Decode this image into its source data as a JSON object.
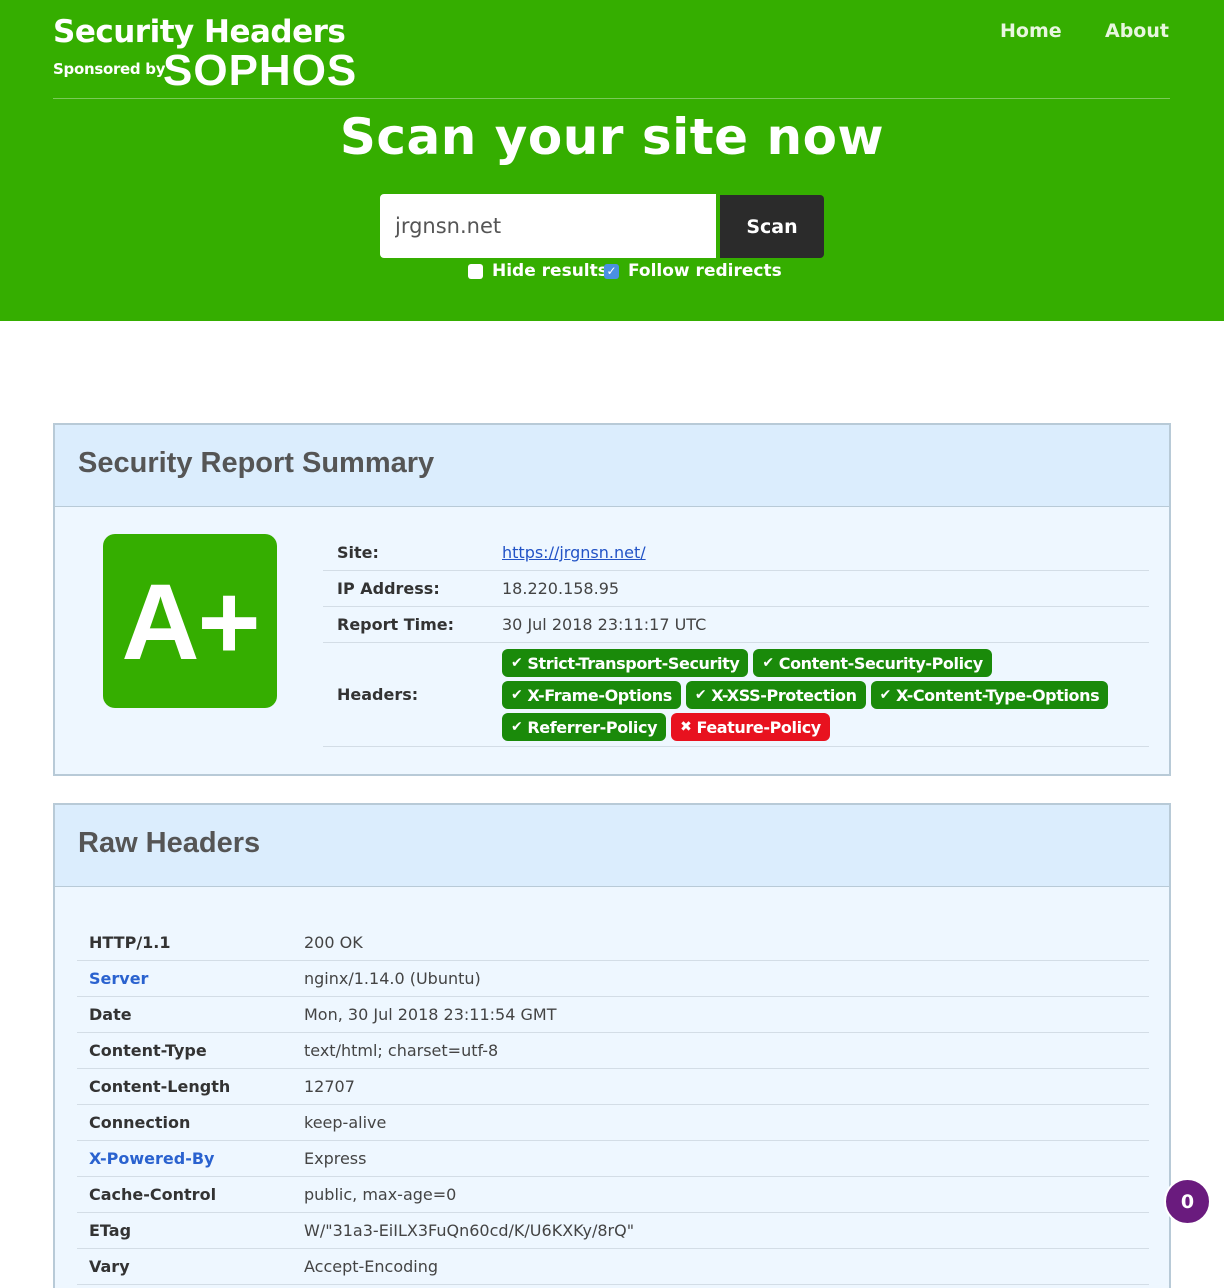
{
  "header": {
    "title": "Security Headers",
    "sponsored_by": "Sponsored by",
    "sponsor": "SOPHOS",
    "nav": {
      "home": "Home",
      "about": "About"
    },
    "heading": "Scan your site now",
    "search": {
      "value": "jrgnsn.net",
      "button": "Scan"
    },
    "options": {
      "hide_results": "Hide results",
      "hide_checked": false,
      "follow_redirects": "Follow redirects",
      "follow_checked": true
    }
  },
  "summary": {
    "title": "Security Report Summary",
    "grade": "A+",
    "site_label": "Site:",
    "site_value": "https://jrgnsn.net/",
    "ip_label": "IP Address:",
    "ip_value": "18.220.158.95",
    "time_label": "Report Time:",
    "time_value": "30 Jul 2018 23:11:17 UTC",
    "headers_label": "Headers:",
    "headers": [
      {
        "name": "Strict-Transport-Security",
        "status": "pass"
      },
      {
        "name": "Content-Security-Policy",
        "status": "pass"
      },
      {
        "name": "X-Frame-Options",
        "status": "pass"
      },
      {
        "name": "X-XSS-Protection",
        "status": "pass"
      },
      {
        "name": "X-Content-Type-Options",
        "status": "pass"
      },
      {
        "name": "Referrer-Policy",
        "status": "pass"
      },
      {
        "name": "Feature-Policy",
        "status": "fail"
      }
    ]
  },
  "raw": {
    "title": "Raw Headers",
    "rows": [
      {
        "key": "HTTP/1.1",
        "value": "200 OK",
        "highlight": false
      },
      {
        "key": "Server",
        "value": "nginx/1.14.0 (Ubuntu)",
        "highlight": true
      },
      {
        "key": "Date",
        "value": "Mon, 30 Jul 2018 23:11:54 GMT",
        "highlight": false
      },
      {
        "key": "Content-Type",
        "value": "text/html; charset=utf-8",
        "highlight": false
      },
      {
        "key": "Content-Length",
        "value": "12707",
        "highlight": false
      },
      {
        "key": "Connection",
        "value": "keep-alive",
        "highlight": false
      },
      {
        "key": "X-Powered-By",
        "value": "Express",
        "highlight": true
      },
      {
        "key": "Cache-Control",
        "value": "public, max-age=0",
        "highlight": false
      },
      {
        "key": "ETag",
        "value": "W/\"31a3-EiILX3FuQn60cd/K/U6KXKy/8rQ\"",
        "highlight": false
      },
      {
        "key": "Vary",
        "value": "Accept-Encoding",
        "highlight": false
      }
    ]
  },
  "counter": "0",
  "colors": {
    "brand_green": "#35ae00",
    "pass": "#1a8a0a",
    "fail": "#e8121f",
    "link": "#2253c6"
  }
}
